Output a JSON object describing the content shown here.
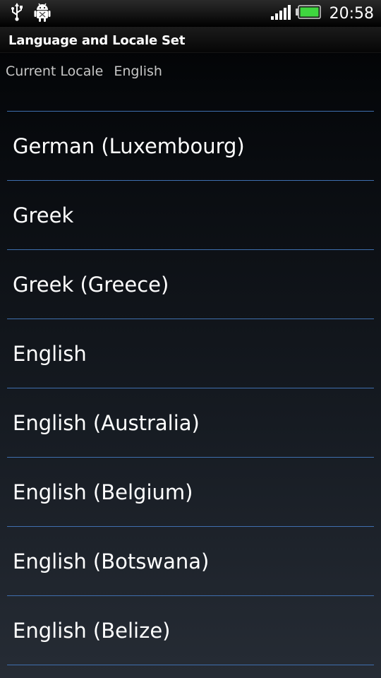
{
  "status_bar": {
    "icons": [
      "usb-icon",
      "android-debug-icon",
      "signal-strength-icon",
      "battery-icon"
    ],
    "time": "20:58",
    "battery_color": "#3fd63f"
  },
  "title_bar": {
    "title": "Language and Locale Set"
  },
  "current_locale": {
    "label": "Current Locale",
    "value": "English"
  },
  "languages": [
    "German (Luxembourg)",
    "Greek",
    "Greek (Greece)",
    "English",
    "English (Australia)",
    "English (Belgium)",
    "English (Botswana)",
    "English (Belize)"
  ],
  "colors": {
    "divider": "#3f6fae",
    "text_primary": "#ffffff",
    "text_secondary": "#c7c7c7"
  }
}
